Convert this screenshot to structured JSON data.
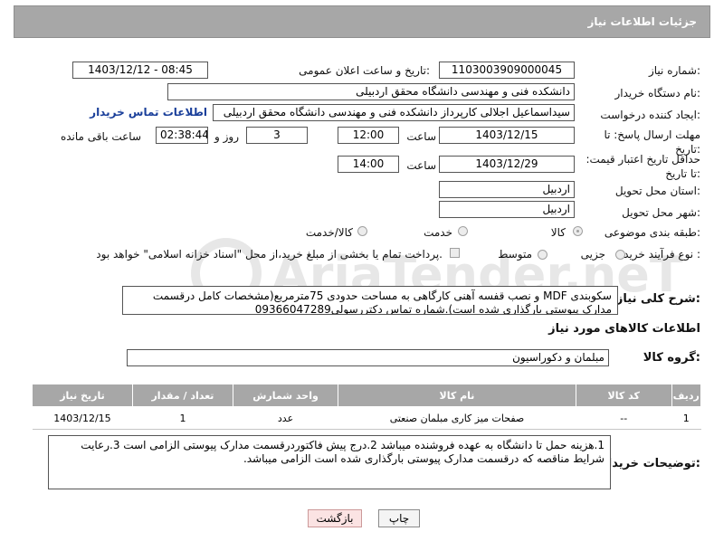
{
  "header": {
    "title": "جزئیات اطلاعات نیاز"
  },
  "labels": {
    "need_number": "شماره نیاز:",
    "announce_datetime": "تاریخ و ساعت اعلان عمومی:",
    "buyer_org": "نام دستگاه خریدار:",
    "requester": "ایجاد کننده درخواست:",
    "reply_deadline": "مهلت ارسال پاسخ: تا تاریخ:",
    "time": "ساعت",
    "days_and": "روز و",
    "hours_remaining": "ساعت باقی مانده",
    "min_price_validity": "حداقل تاریخ اعتبار قیمت: تا تاریخ:",
    "delivery_province": "استان محل تحویل:",
    "delivery_city": "شهر محل تحویل:",
    "category": "طبقه بندی موضوعی:",
    "purchase_type": "نوع فرآیند خرید :",
    "description": "شرح کلی نیاز:",
    "goods_info": "اطلاعات کالاهای مورد نیاز",
    "goods_group": "گروه کالا:",
    "buyer_notes": "توضیحات خریدار:"
  },
  "fields": {
    "need_number": "1103003909000045",
    "announce_datetime": "1403/12/12 - 08:45",
    "buyer_org": "دانشکده فنی و مهندسی دانشگاه محقق اردبیلی",
    "requester": "سیداسماعیل اجلالی کارپرداز دانشکده فنی و مهندسی دانشگاه محقق اردبیلی",
    "contact_link": "اطلاعات تماس خریدار",
    "reply_date": "1403/12/15",
    "reply_time": "12:00",
    "days": "3",
    "remaining": "02:38:44",
    "price_date": "1403/12/29",
    "price_time": "14:00",
    "province": "اردبیل",
    "city": "اردبیل",
    "description": "سکوبندی MDF و نصب قفسه آهنی کارگاهی به مساحت حدودی 75مترمربع(مشخصات کامل درقسمت مدارک پیوستی بارگذاری شده است).شماره تماس دکتررسولی09366047289",
    "goods_group": "مبلمان و دکوراسیون",
    "buyer_notes": "1.هزینه حمل تا دانشگاه به عهده فروشنده میباشد 2.درج پیش فاکتوردرقسمت مدارک پیوستی الزامی است 3.رعایت شرایط مناقصه که درقسمت مدارک پیوستی بارگذاری شده است الزامی میباشد."
  },
  "category_options": [
    {
      "label": "کالا",
      "checked": true
    },
    {
      "label": "خدمت",
      "checked": false
    },
    {
      "label": "کالا/خدمت",
      "checked": false
    }
  ],
  "purchase_options": [
    {
      "label": "جزیی",
      "checked": false
    },
    {
      "label": "متوسط",
      "checked": false
    }
  ],
  "payment_note": "پرداخت تمام یا بخشی از مبلغ خرید،از محل \"اسناد خزانه اسلامی\" خواهد بود.",
  "table": {
    "headers": [
      "ردیف",
      "کد کالا",
      "نام کالا",
      "واحد شمارش",
      "تعداد / مقدار",
      "تاریخ نیاز"
    ],
    "rows": [
      [
        "1",
        "--",
        "صفحات میز کاری مبلمان صنعتی",
        "عدد",
        "1",
        "1403/12/15"
      ]
    ]
  },
  "buttons": {
    "print": "چاپ",
    "back": "بازگشت"
  },
  "watermark": {
    "text": "AriaTender.neT"
  }
}
